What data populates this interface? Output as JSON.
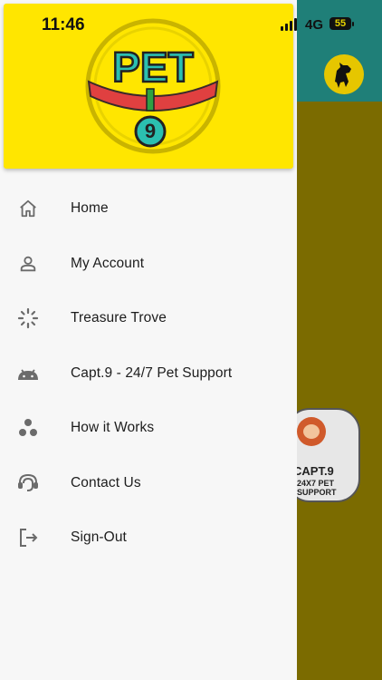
{
  "status_bar": {
    "time": "11:46",
    "network": "4G",
    "battery": "55"
  },
  "drawer": {
    "logo": {
      "word": "PET",
      "number": "9"
    },
    "menu": [
      {
        "label": "Home",
        "icon": "home-icon"
      },
      {
        "label": "My Account",
        "icon": "account-icon"
      },
      {
        "label": "Treasure Trove",
        "icon": "loading-spinner-icon"
      },
      {
        "label": "Capt.9 - 24/7 Pet Support",
        "icon": "android-icon"
      },
      {
        "label": "How it Works",
        "icon": "bubble-chart-icon"
      },
      {
        "label": "Contact Us",
        "icon": "support-agent-icon"
      },
      {
        "label": "Sign-Out",
        "icon": "logout-icon"
      }
    ]
  },
  "background": {
    "fab": {
      "line1": "CAPT.9",
      "line2": "24X7 PET",
      "line3": "SUPPORT"
    }
  },
  "colors": {
    "header_yellow": "#ffe600",
    "app_teal": "#1f7f78",
    "scrim_olive": "#7b6b00",
    "logo_teal": "#2bbfb0",
    "collar_red": "#e04040"
  }
}
